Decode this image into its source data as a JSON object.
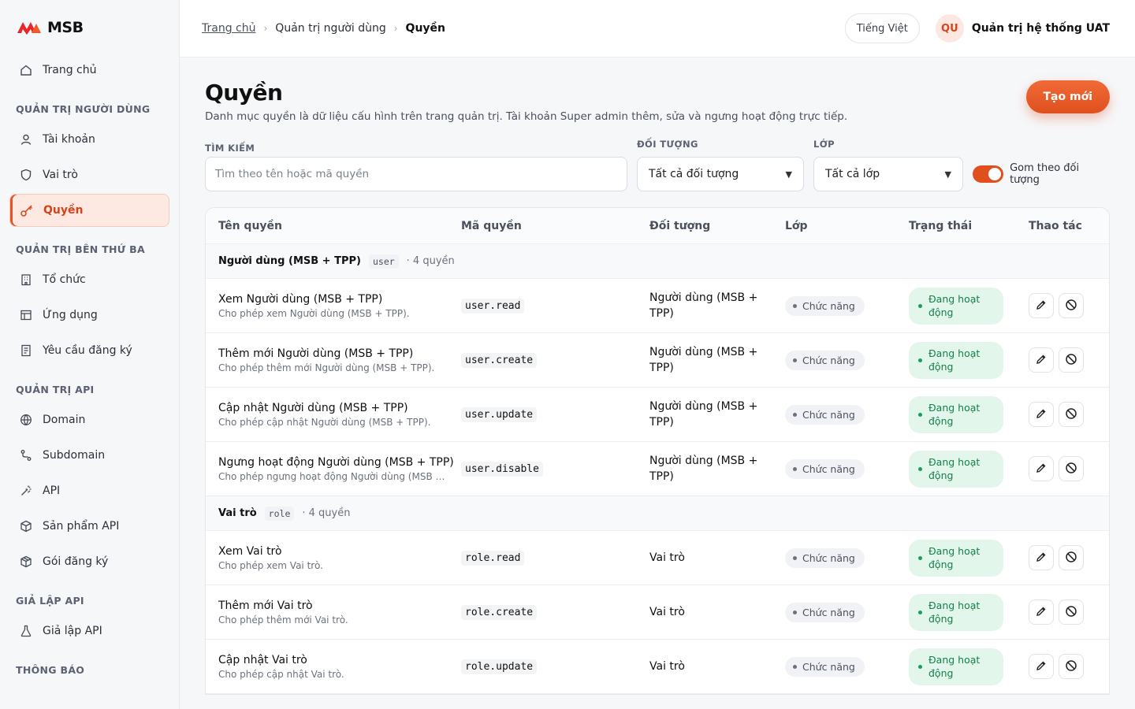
{
  "brand": {
    "name": "MSB"
  },
  "sidebar": {
    "home": "Trang chủ",
    "sections": [
      {
        "title": "QUẢN TRỊ NGƯỜI DÙNG",
        "items": [
          "Tài khoản",
          "Vai trò",
          "Quyền"
        ]
      },
      {
        "title": "QUẢN TRỊ BÊN THỨ BA",
        "items": [
          "Tổ chức",
          "Ứng dụng",
          "Yêu cầu đăng ký"
        ]
      },
      {
        "title": "QUẢN TRỊ API",
        "items": [
          "Domain",
          "Subdomain",
          "API",
          "Sản phẩm API",
          "Gói đăng ký"
        ]
      },
      {
        "title": "GIẢ LẬP API",
        "items": [
          "Giả lập API"
        ]
      },
      {
        "title": "THÔNG BÁO",
        "items": []
      }
    ],
    "active": "Quyền"
  },
  "topbar": {
    "breadcrumb": [
      "Trang chủ",
      "Quản trị người dùng",
      "Quyền"
    ],
    "language": "Tiếng Việt",
    "avatar_initials": "QU",
    "user_name": "Quản trị hệ thống UAT"
  },
  "page": {
    "title": "Quyền",
    "description": "Danh mục quyền là dữ liệu cấu hình trên trang quản trị. Tài khoản Super admin thêm, sửa và ngưng hoạt động trực tiếp.",
    "create_label": "Tạo mới"
  },
  "filters": {
    "search_label": "TÌM KIẾM",
    "search_placeholder": "Tìm theo tên hoặc mã quyền",
    "object_label": "ĐỐI TƯỢNG",
    "object_value": "Tất cả đối tượng",
    "class_label": "LỚP",
    "class_value": "Tất cả lớp",
    "group_toggle_label": "Gom theo đối tượng",
    "group_toggle_on": true
  },
  "table": {
    "headers": [
      "Tên quyền",
      "Mã quyền",
      "Đối tượng",
      "Lớp",
      "Trạng thái",
      "Thao tác"
    ],
    "groups": [
      {
        "name": "Người dùng (MSB + TPP)",
        "code": "user",
        "count": "· 4 quyền",
        "rows": [
          {
            "name": "Xem Người dùng (MSB + TPP)",
            "desc": "Cho phép xem Người dùng (MSB + TPP).",
            "code": "user.read",
            "object": "Người dùng (MSB + TPP)",
            "class": "Chức năng",
            "status": "Đang hoạt động"
          },
          {
            "name": "Thêm mới Người dùng (MSB + TPP)",
            "desc": "Cho phép thêm mới Người dùng (MSB + TPP).",
            "code": "user.create",
            "object": "Người dùng (MSB + TPP)",
            "class": "Chức năng",
            "status": "Đang hoạt động"
          },
          {
            "name": "Cập nhật Người dùng (MSB + TPP)",
            "desc": "Cho phép cập nhật Người dùng (MSB + TPP).",
            "code": "user.update",
            "object": "Người dùng (MSB + TPP)",
            "class": "Chức năng",
            "status": "Đang hoạt động"
          },
          {
            "name": "Ngưng hoạt động Người dùng (MSB + TPP)",
            "desc": "Cho phép ngưng hoạt động Người dùng (MSB + T...",
            "code": "user.disable",
            "object": "Người dùng (MSB + TPP)",
            "class": "Chức năng",
            "status": "Đang hoạt động"
          }
        ]
      },
      {
        "name": "Vai trò",
        "code": "role",
        "count": "· 4 quyền",
        "rows": [
          {
            "name": "Xem Vai trò",
            "desc": "Cho phép xem Vai trò.",
            "code": "role.read",
            "object": "Vai trò",
            "class": "Chức năng",
            "status": "Đang hoạt động"
          },
          {
            "name": "Thêm mới Vai trò",
            "desc": "Cho phép thêm mới Vai trò.",
            "code": "role.create",
            "object": "Vai trò",
            "class": "Chức năng",
            "status": "Đang hoạt động"
          },
          {
            "name": "Cập nhật Vai trò",
            "desc": "Cho phép cập nhật Vai trò.",
            "code": "role.update",
            "object": "Vai trò",
            "class": "Chức năng",
            "status": "Đang hoạt động"
          }
        ]
      }
    ]
  },
  "colors": {
    "accent": "#e0501f",
    "active_bg": "#fde9e2",
    "status_bg": "#e3f6ec",
    "status_text": "#16804a"
  }
}
